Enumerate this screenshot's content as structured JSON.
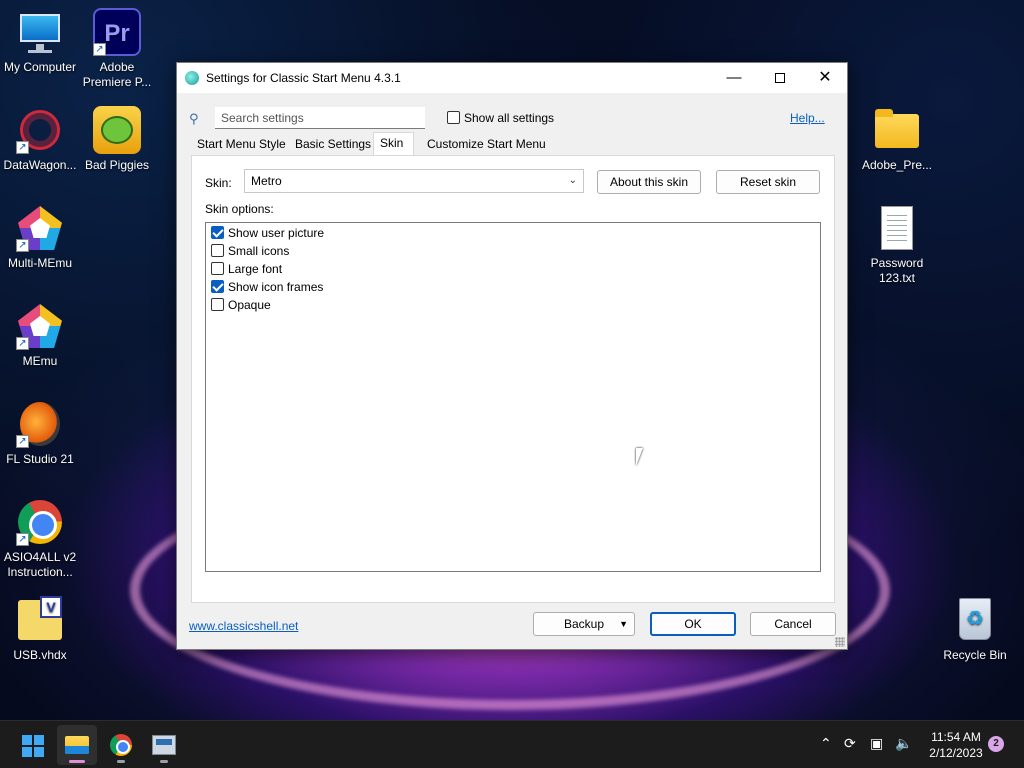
{
  "desktop": {
    "icons_left": [
      {
        "label": "My Computer"
      },
      {
        "label": "Adobe Premiere P..."
      },
      {
        "label": "DataWagon..."
      },
      {
        "label": "Bad Piggies"
      },
      {
        "label": "Multi-MEmu"
      },
      {
        "label": "MEmu"
      },
      {
        "label": "FL Studio 21"
      },
      {
        "label": "ASIO4ALL v2 Instruction..."
      },
      {
        "label": "USB.vhdx"
      }
    ],
    "icons_right": [
      {
        "label": "Adobe_Pre..."
      },
      {
        "label": "Password 123.txt"
      },
      {
        "label": "Recycle Bin"
      }
    ],
    "premiere_glyph": "Pr",
    "vhdx_glyph": "V"
  },
  "window": {
    "title": "Settings for Classic Start Menu 4.3.1",
    "search": {
      "placeholder": "Search settings",
      "value": ""
    },
    "show_all_label": "Show all settings",
    "show_all_checked": false,
    "help_label": "Help...",
    "tabs": [
      {
        "label": "Start Menu Style",
        "active": false
      },
      {
        "label": "Basic Settings",
        "active": false
      },
      {
        "label": "Skin",
        "active": true
      },
      {
        "label": "Customize Start Menu",
        "active": false
      }
    ],
    "skin": {
      "label": "Skin:",
      "selected": "Metro",
      "about_button": "About this skin",
      "reset_button": "Reset skin"
    },
    "skin_options_label": "Skin options:",
    "skin_options": [
      {
        "label": "Show user picture",
        "checked": true
      },
      {
        "label": "Small icons",
        "checked": false
      },
      {
        "label": "Large font",
        "checked": false
      },
      {
        "label": "Show icon frames",
        "checked": true
      },
      {
        "label": "Opaque",
        "checked": false
      }
    ],
    "footer": {
      "link": "www.classicshell.net",
      "backup_button": "Backup",
      "ok_button": "OK",
      "cancel_button": "Cancel"
    }
  },
  "taskbar": {
    "time": "11:54 AM",
    "date": "2/12/2023",
    "notification_count": "2"
  },
  "colors": {
    "accent": "#0a5ec2",
    "taskbar": "#1c1c1c"
  }
}
